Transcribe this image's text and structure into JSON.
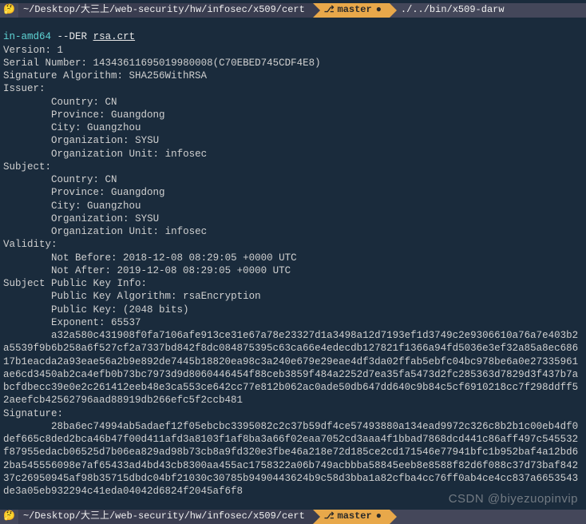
{
  "prompt_top": {
    "emoji": "🤔",
    "path": "~/Desktop/大三上/web-security/hw/infosec/x509/cert",
    "branch_icon": "⎇",
    "branch": "master",
    "bullet": "●",
    "command": "./../bin/x509-darw"
  },
  "continuation": {
    "prefix": "in-amd64",
    "flag": "--DER",
    "file": "rsa.crt"
  },
  "cert": {
    "version_label": "Version:",
    "version": "1",
    "serial_label": "Serial Number:",
    "serial": "14343611695019980008(C70EBED745CDF4E8)",
    "sig_algo_label": "Signature Algorithm:",
    "sig_algo": "SHA256WithRSA",
    "issuer_label": "Issuer:",
    "issuer": {
      "country_label": "Country:",
      "country": "CN",
      "province_label": "Province:",
      "province": "Guangdong",
      "city_label": "City:",
      "city": "Guangzhou",
      "org_label": "Organization:",
      "org": "SYSU",
      "ou_label": "Organization Unit:",
      "ou": "infosec"
    },
    "subject_label": "Subject:",
    "subject": {
      "country_label": "Country:",
      "country": "CN",
      "province_label": "Province:",
      "province": "Guangdong",
      "city_label": "City:",
      "city": "Guangzhou",
      "org_label": "Organization:",
      "org": "SYSU",
      "ou_label": "Organization Unit:",
      "ou": "infosec"
    },
    "validity_label": "Validity:",
    "validity": {
      "not_before_label": "Not Before:",
      "not_before": "2018-12-08 08:29:05 +0000 UTC",
      "not_after_label": "Not After:",
      "not_after": "2019-12-08 08:29:05 +0000 UTC"
    },
    "spki_label": "Subject Public Key Info:",
    "spki": {
      "algo_label": "Public Key Algorithm:",
      "algo": "rsaEncryption",
      "pubkey_label": "Public Key:",
      "pubkey": "(2048 bits)",
      "exponent_label": "Exponent:",
      "exponent": "65537",
      "modulus": "        a32a580c431908f0fa7106afe913ce31e67a78e23327d1a3498a12d7193ef1d3749c2e9306610a76a7e403b2a5539f9b6b258a6f527cf2a7337bd842f8dc084875395c63ca66e4edecdb127821f1366a94fd5036e3ef32a85a8ec68617b1eacda2a93eae56a2b9e892de7445b18820ea98c3a240e679e29eae4df3da02ffab5ebfc04bc978be6a0e27335961ae6cd3450ab2ca4efb0b73bc7973d9d8060446454f88ceb3859f484a2252d7ea35fa5473d2fc285363d7829d3f437b7abcfdbecc39e0e2c261412eeb48e3ca553ce642cc77e812b062ac0ade50db647dd640c9b84c5cf6910218cc7f298ddff52aeefcb42562796aad88919db266efc5f2ccb481"
    },
    "signature_label": "Signature:",
    "signature": "        28ba6ec74994ab5adaef12f05ebcbc3395082c2c37b59df4ce57493880a134ead9972c326c8b2b1c00eb4df0def665c8ded2bca46b47f00d411afd3a8103f1af8ba3a66f02eaa7052cd3aaa4f1bbad7868dcd441c86aff497c545532f87955edacb06525d7b06ea829ad98b73cb8a9fd320e3fbe46a218e72d185ce2cd171546e77941bfc1b952baf4a12bd62ba545556098e7af65433ad4bd43cb8300aa455ac1758322a06b749acbbba58845eeb8e8588f82d6f088c37d73baf84237c26950945af98b35715dbdc04bf21030c30785b9490443624b9c58d3bba1a82cfba4cc76ff0ab4ce4cc837a6653543de3a05eb932294c41eda04042d6824f2045af6f8"
  },
  "prompt_bottom": {
    "emoji": "🤔",
    "path": "~/Desktop/大三上/web-security/hw/infosec/x509/cert",
    "branch_icon": "⎇",
    "branch": "master",
    "bullet": "●"
  },
  "watermark": "CSDN @biyezuopinvip"
}
